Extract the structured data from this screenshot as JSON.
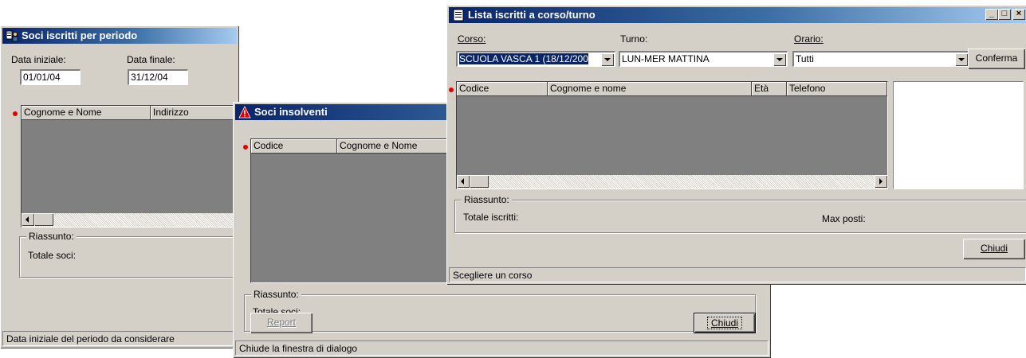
{
  "win1": {
    "title": "Soci iscritti per periodo",
    "data_iniziale_label": "Data iniziale:",
    "data_iniziale_value": "01/01/04",
    "data_finale_label": "Data finale:",
    "data_finale_value": "31/12/04",
    "columns": [
      "Cognome e Nome",
      "Indirizzo"
    ],
    "riassunto_label": "Riassunto:",
    "totale_label": "Totale soci:",
    "status": "Data iniziale del periodo da considerare"
  },
  "win2": {
    "title": "Soci insolventi",
    "columns": [
      "Codice",
      "Cognome e Nome"
    ],
    "riassunto_label": "Riassunto:",
    "totale_label": "Totale soci:",
    "report_button": "Report",
    "chiudi_button": "Chiudi",
    "status": "Chiude la finestra di dialogo"
  },
  "win3": {
    "title": "Lista iscritti a corso/turno",
    "corso_label": "Corso:",
    "corso_value": "SCUOLA VASCA 1 (18/12/200",
    "turno_label": "Turno:",
    "turno_value": "LUN-MER MATTINA",
    "orario_label": "Orario:",
    "orario_value": "Tutti",
    "conferma_button": "Conferma",
    "columns": [
      "Codice",
      "Cognome e nome",
      "Età",
      "Telefono"
    ],
    "riassunto_label": "Riassunto:",
    "totale_label": "Totale iscritti:",
    "max_posti_label": "Max posti:",
    "chiudi_button": "Chiudi",
    "status": "Scegliere un corso"
  },
  "colors": {
    "title_start": "#0a246a",
    "title_end": "#a6caf0",
    "face": "#d4d0c8",
    "grid_body": "#808080",
    "indicator_dot": "#e00000"
  }
}
